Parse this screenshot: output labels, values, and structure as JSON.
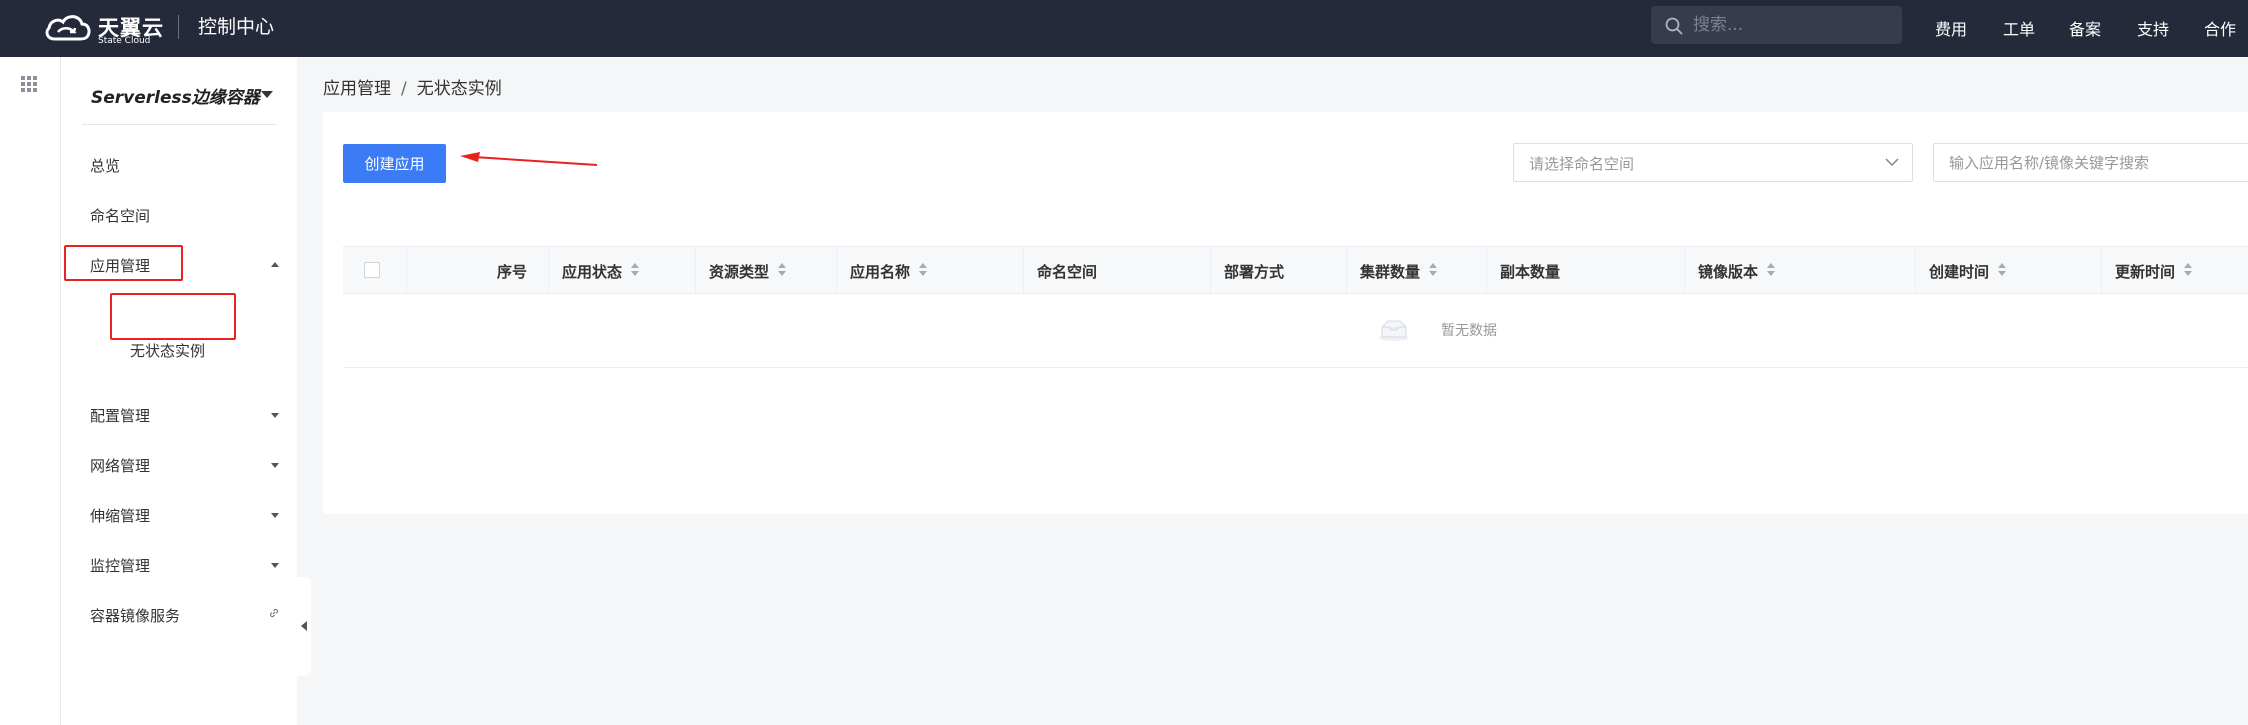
{
  "header": {
    "brand_cn": "天翼云",
    "brand_en": "State Cloud",
    "console_title": "控制中心",
    "search_placeholder": "搜索...",
    "nav": [
      "费用",
      "工单",
      "备案",
      "支持",
      "合作"
    ]
  },
  "sidebar": {
    "product": "Serverless边缘容器",
    "items": [
      {
        "label": "总览"
      },
      {
        "label": "命名空间"
      },
      {
        "label": "应用管理",
        "expanded": true,
        "sub": [
          {
            "label": "无状态实例"
          }
        ]
      },
      {
        "label": "配置管理"
      },
      {
        "label": "网络管理"
      },
      {
        "label": "伸缩管理"
      },
      {
        "label": "监控管理"
      },
      {
        "label": "容器镜像服务"
      }
    ]
  },
  "breadcrumb": [
    "应用管理",
    "/",
    "无状态实例"
  ],
  "toolbar": {
    "create_label": "创建应用",
    "namespace_placeholder": "请选择命名空间",
    "keyword_placeholder": "输入应用名称/镜像关键字搜索"
  },
  "table": {
    "columns": [
      "序号",
      "应用状态",
      "资源类型",
      "应用名称",
      "命名空间",
      "部署方式",
      "集群数量",
      "副本数量",
      "镜像版本",
      "创建时间",
      "更新时间"
    ],
    "empty_text": "暂无数据"
  },
  "colors": {
    "topbar": "#252a3a",
    "primary": "#3b7cf6",
    "highlight": "#e8231e"
  }
}
